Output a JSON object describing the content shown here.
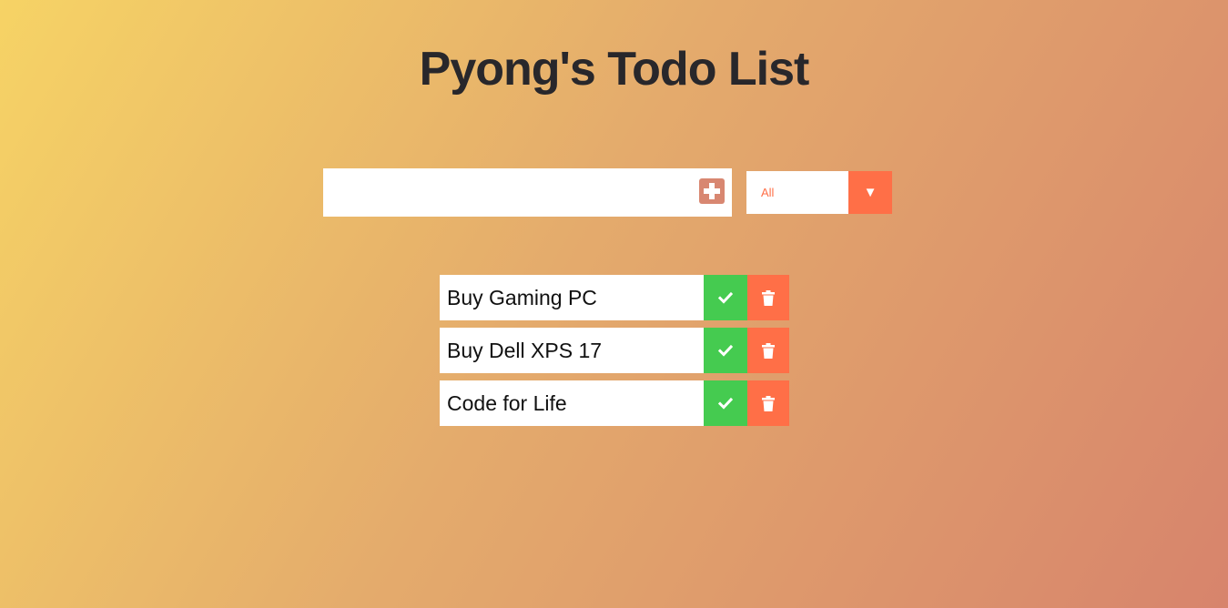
{
  "header": {
    "title": "Pyong's Todo List"
  },
  "form": {
    "input_value": "",
    "input_placeholder": "",
    "add_icon": "plus-square-icon"
  },
  "filter": {
    "selected": "All",
    "arrow_glyph": "▼"
  },
  "todos": [
    {
      "text": "Buy Gaming PC",
      "complete_icon": "check-icon",
      "delete_icon": "trash-icon"
    },
    {
      "text": "Buy Dell XPS 17",
      "complete_icon": "check-icon",
      "delete_icon": "trash-icon"
    },
    {
      "text": "Code for Life",
      "complete_icon": "check-icon",
      "delete_icon": "trash-icon"
    }
  ],
  "colors": {
    "gradient_start": "#f6d365",
    "gradient_end": "#d7846c",
    "accent": "#ff6f47",
    "complete": "#45cb50",
    "add_button": "#d88771",
    "title": "#28272b"
  }
}
